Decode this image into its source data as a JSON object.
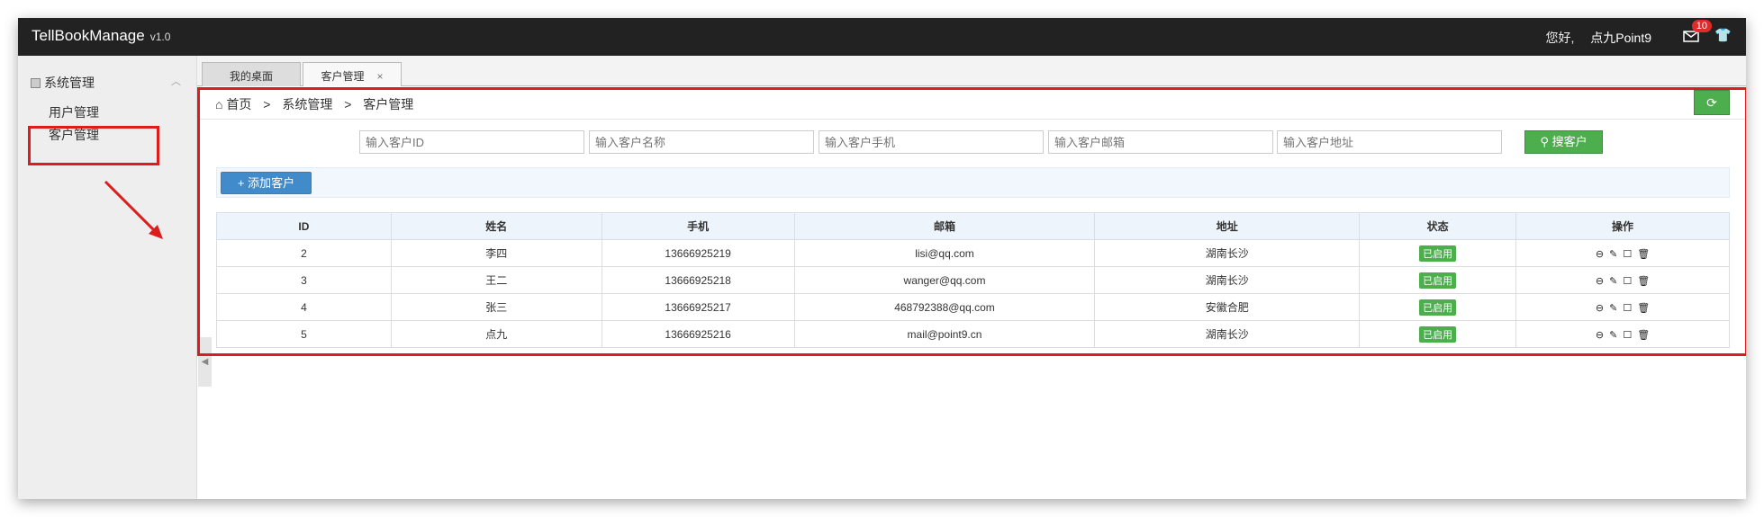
{
  "header": {
    "app_title": "TellBookManage",
    "version": "v1.0",
    "greeting": "您好,",
    "username": "点九Point9",
    "mail_badge": "10"
  },
  "sidebar": {
    "group_label": "系统管理",
    "items": [
      {
        "label": "用户管理"
      },
      {
        "label": "客户管理"
      }
    ]
  },
  "tabs": [
    {
      "label": "我的桌面"
    },
    {
      "label": "客户管理",
      "close": "×"
    }
  ],
  "breadcrumb": {
    "home": "首页",
    "sep": ">",
    "level1": "系统管理",
    "level2": "客户管理"
  },
  "search": {
    "id_placeholder": "输入客户ID",
    "name_placeholder": "输入客户名称",
    "phone_placeholder": "输入客户手机",
    "email_placeholder": "输入客户邮箱",
    "address_placeholder": "输入客户地址",
    "button_label": "搜客户"
  },
  "toolbar": {
    "add_label": "添加客户"
  },
  "table": {
    "headers": [
      "ID",
      "姓名",
      "手机",
      "邮箱",
      "地址",
      "状态",
      "操作"
    ],
    "rows": [
      {
        "id": "2",
        "name": "李四",
        "phone": "13666925219",
        "email": "lisi@qq.com",
        "address": "湖南长沙",
        "status": "已启用"
      },
      {
        "id": "3",
        "name": "王二",
        "phone": "13666925218",
        "email": "wanger@qq.com",
        "address": "湖南长沙",
        "status": "已启用"
      },
      {
        "id": "4",
        "name": "张三",
        "phone": "13666925217",
        "email": "468792388@qq.com",
        "address": "安徽合肥",
        "status": "已启用"
      },
      {
        "id": "5",
        "name": "点九",
        "phone": "13666925216",
        "email": "mail@point9.cn",
        "address": "湖南长沙",
        "status": "已启用"
      }
    ]
  },
  "colors": {
    "highlight": "#dd1c1c",
    "success": "#4cae4c",
    "primary": "#428bca",
    "topbar": "#222222"
  },
  "icons": [
    "home-icon",
    "refresh-icon",
    "search-icon",
    "plus-icon",
    "stop-icon",
    "edit-icon",
    "square-icon",
    "trash-icon",
    "mail-icon",
    "shirt-icon"
  ]
}
